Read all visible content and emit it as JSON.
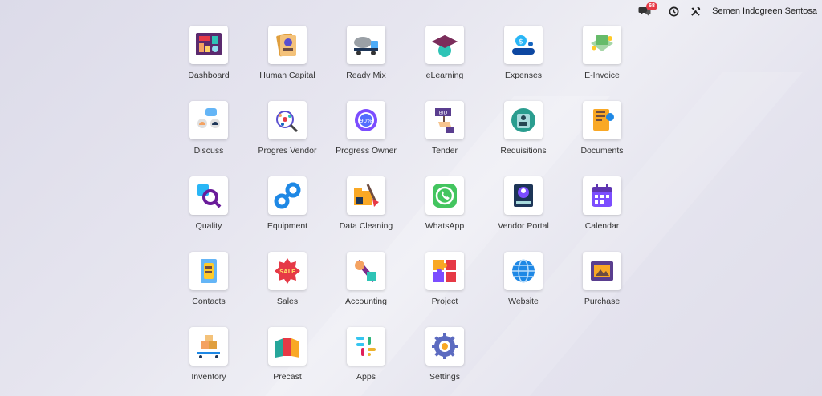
{
  "topbar": {
    "messages_badge": "68",
    "company": "Semen Indogreen Sentosa"
  },
  "apps": [
    {
      "label": "Dashboard",
      "icon": "dashboard-icon"
    },
    {
      "label": "Human Capital",
      "icon": "human-capital-icon"
    },
    {
      "label": "Ready Mix",
      "icon": "ready-mix-truck-icon"
    },
    {
      "label": "eLearning",
      "icon": "graduation-cap-icon"
    },
    {
      "label": "Expenses",
      "icon": "expenses-icon"
    },
    {
      "label": "E-Invoice",
      "icon": "e-invoice-icon"
    },
    {
      "label": "Discuss",
      "icon": "discuss-icon"
    },
    {
      "label": "Progres Vendor",
      "icon": "progress-vendor-icon"
    },
    {
      "label": "Progress Owner",
      "icon": "progress-owner-icon",
      "badge": "90%"
    },
    {
      "label": "Tender",
      "icon": "tender-bid-icon",
      "badge": "BID"
    },
    {
      "label": "Requisitions",
      "icon": "requisitions-icon"
    },
    {
      "label": "Documents",
      "icon": "documents-icon"
    },
    {
      "label": "Quality",
      "icon": "quality-icon"
    },
    {
      "label": "Equipment",
      "icon": "equipment-icon"
    },
    {
      "label": "Data Cleaning",
      "icon": "data-cleaning-icon"
    },
    {
      "label": "WhatsApp",
      "icon": "whatsapp-icon"
    },
    {
      "label": "Vendor Portal",
      "icon": "vendor-portal-icon"
    },
    {
      "label": "Calendar",
      "icon": "calendar-icon"
    },
    {
      "label": "Contacts",
      "icon": "contacts-icon"
    },
    {
      "label": "Sales",
      "icon": "sales-icon",
      "badge": "SALE"
    },
    {
      "label": "Accounting",
      "icon": "accounting-icon"
    },
    {
      "label": "Project",
      "icon": "project-puzzle-icon"
    },
    {
      "label": "Website",
      "icon": "website-globe-icon"
    },
    {
      "label": "Purchase",
      "icon": "purchase-icon"
    },
    {
      "label": "Inventory",
      "icon": "inventory-icon"
    },
    {
      "label": "Precast",
      "icon": "precast-icon"
    },
    {
      "label": "Apps",
      "icon": "apps-icon"
    },
    {
      "label": "Settings",
      "icon": "settings-gear-icon"
    }
  ]
}
